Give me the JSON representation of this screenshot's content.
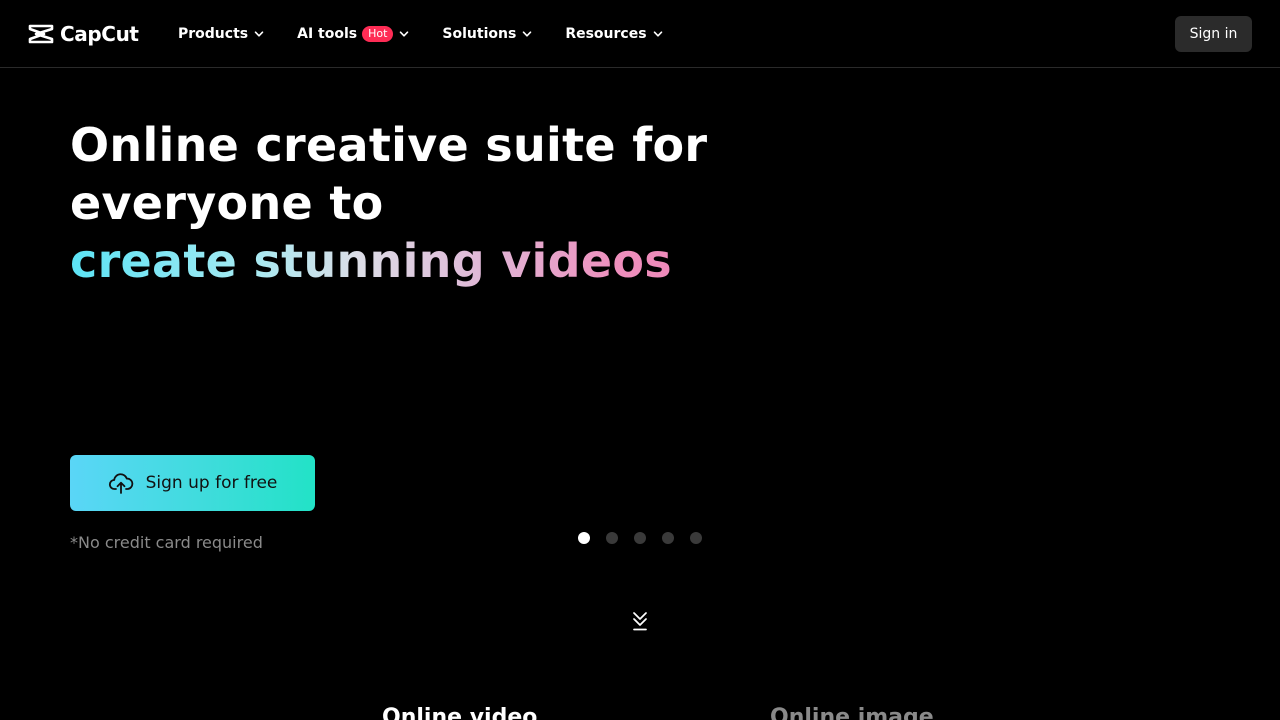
{
  "brand": {
    "name": "CapCut",
    "logo_icon": "capcut-logo-icon"
  },
  "nav": {
    "items": [
      {
        "label": "Products"
      },
      {
        "label": "AI tools",
        "badge": "Hot"
      },
      {
        "label": "Solutions"
      },
      {
        "label": "Resources"
      }
    ],
    "signin_label": "Sign in"
  },
  "hero": {
    "title_line1": "Online creative suite for",
    "title_line2": "everyone to",
    "title_line3": "create stunning videos",
    "cta_label": "Sign up for free",
    "cta_icon": "cloud-upload-icon",
    "note": "*No credit card required"
  },
  "carousel": {
    "slide_count": 5,
    "active_index": 0
  },
  "tabs": [
    {
      "label": "Online video"
    },
    {
      "label": "Online image"
    }
  ],
  "colors": {
    "background": "#000000",
    "cta_gradient_start": "#5ad6f7",
    "cta_gradient_end": "#22e2c7",
    "hot_badge": "#fe2c55",
    "signin_bg": "#2b2b2b"
  }
}
